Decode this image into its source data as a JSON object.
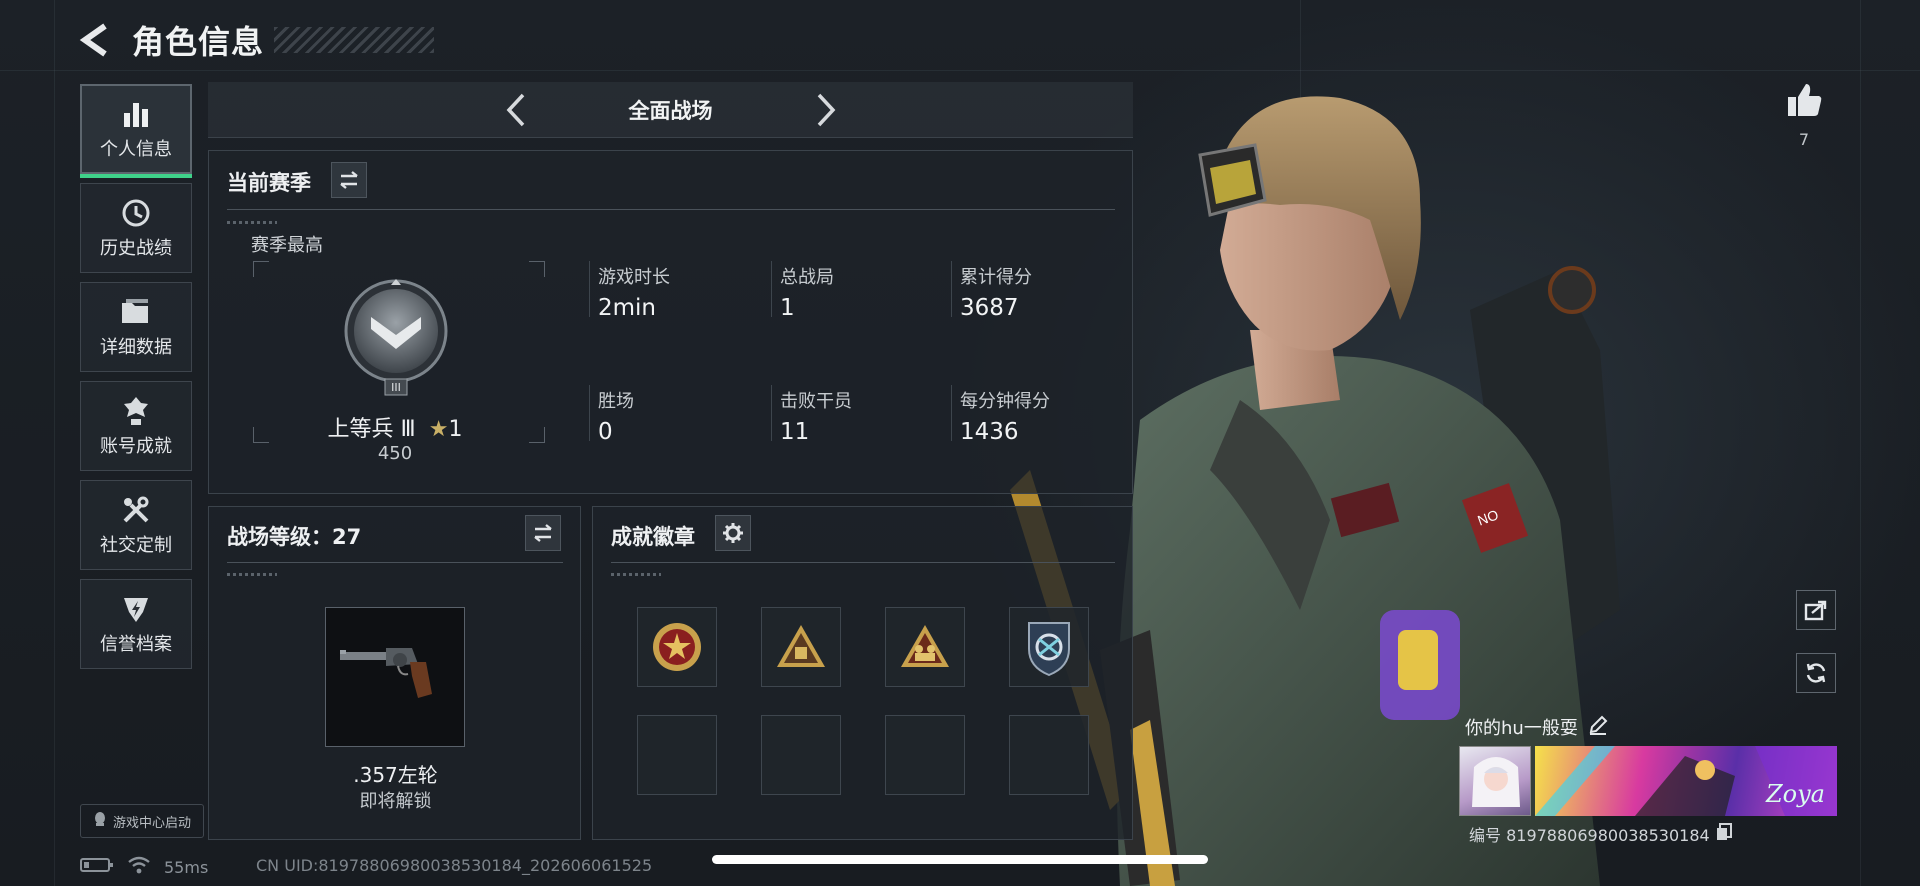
{
  "header": {
    "title": "角色信息"
  },
  "sidebar": {
    "items": [
      {
        "label": "个人信息",
        "icon": "bar-chart-icon",
        "active": true
      },
      {
        "label": "历史战绩",
        "icon": "history-clock-icon",
        "active": false
      },
      {
        "label": "详细数据",
        "icon": "folder-icon",
        "active": false
      },
      {
        "label": "账号成就",
        "icon": "achievement-icon",
        "active": false
      },
      {
        "label": "社交定制",
        "icon": "tools-icon",
        "active": false
      },
      {
        "label": "信誉档案",
        "icon": "credit-shield-icon",
        "active": false
      }
    ],
    "game_center": "游戏中心启动"
  },
  "mode": {
    "title": "全面战场"
  },
  "season": {
    "title": "当前赛季",
    "best_label": "赛季最高",
    "rank_name": "上等兵 Ⅲ",
    "rank_stars": "1",
    "rank_points": "450",
    "stats": [
      {
        "label": "游戏时长",
        "value": "2min"
      },
      {
        "label": "总战局",
        "value": "1"
      },
      {
        "label": "累计得分",
        "value": "3687"
      },
      {
        "label": "胜场",
        "value": "0"
      },
      {
        "label": "击败干员",
        "value": "11"
      },
      {
        "label": "每分钟得分",
        "value": "1436"
      }
    ]
  },
  "battle_level": {
    "title": "战场等级：27",
    "weapon_name": ".357左轮",
    "weapon_status": "即将解锁"
  },
  "achievements": {
    "title": "成就徽章",
    "badges": [
      "red-star-emblem-icon",
      "gold-triangle-crate-icon",
      "gold-triangle-soldiers-icon",
      "blue-shield-arrows-icon"
    ]
  },
  "right_panel": {
    "like_count": "7",
    "player_name": "你的hu一般耍",
    "player_id": "编号 819788069800385301​84",
    "card_text": "Zoya"
  },
  "status": {
    "ping": "55ms",
    "uid": "CN UID:819788069800385301​84_202606061525"
  },
  "colors": {
    "accent": "#3fd28a",
    "panel_border": "#3b434b",
    "background": "#1a1e24"
  }
}
